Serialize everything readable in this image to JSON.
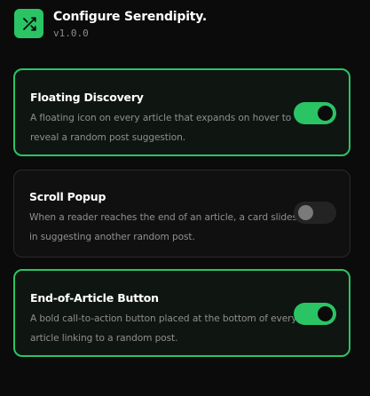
{
  "header": {
    "icon": "shuffle-icon",
    "title": "Configure Serendipity.",
    "version": "v1.0.0"
  },
  "colors": {
    "accent": "#2ac465",
    "background": "#0b0b0b",
    "card_border": "#2a2a2a"
  },
  "features": [
    {
      "title": "Floating Discovery",
      "description": "A floating icon on every article that expands on hover to reveal a random post suggestion.",
      "enabled": true
    },
    {
      "title": "Scroll Popup",
      "description": "When a reader reaches the end of an article, a card slides in suggesting another random post.",
      "enabled": false
    },
    {
      "title": "End-of-Article Button",
      "description": "A bold call-to-action button placed at the bottom of every article linking to a random post.",
      "enabled": true
    }
  ]
}
